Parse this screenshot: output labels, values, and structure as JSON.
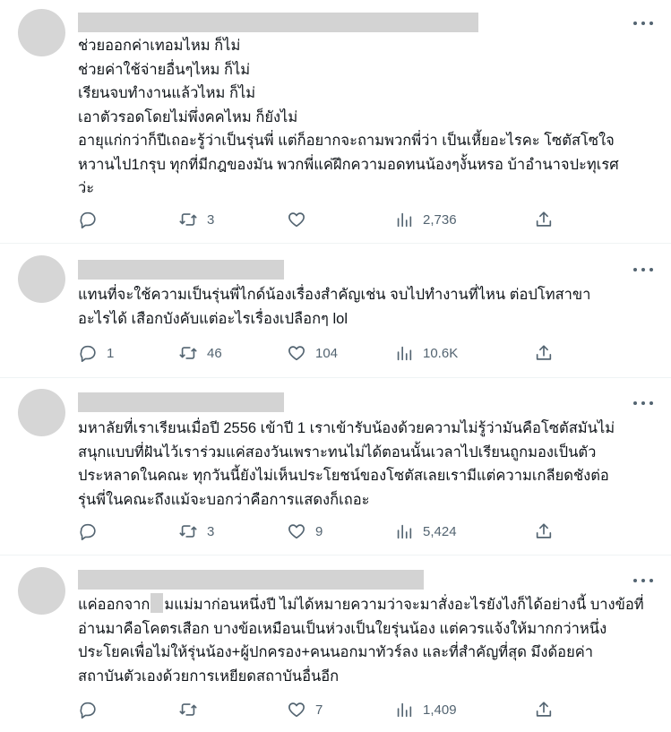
{
  "tweets": [
    {
      "lines": [
        "ช่วยออกค่าเทอมไหม ก็ไม่",
        "ช่วยค่าใช้จ่ายอื่นๆไหม ก็ไม่",
        "เรียนจบทำงานแล้วไหม ก็ไม่",
        "เอาตัวรอดโดยไม่พึ่งคคไหม ก็ยังไม่",
        "อายุแก่กว่าก็ปีเถอะรู้ว่าเป็นรุ่นพี่ แต่ก็อยากจะถามพวกพี่ว่า เป็นเหี้ยอะไรคะ โซตัสโซใจ",
        "หวานไป1กรุบ ทุกที่มีกฎของมัน พวกพี่แค่ฝึกความอดทนน้องๆงั้นหรอ บ้าอำนาจปะทุเรศ",
        "ว่ะ"
      ],
      "reply_count": "",
      "retweet_count": "3",
      "like_count": "",
      "view_count": "2,736"
    },
    {
      "lines": [
        "แทนที่จะใช้ความเป็นรุ่นพี่ไกด์น้องเรื่องสำคัญเช่น จบไปทำงานที่ไหน ต่อปโทสาขา",
        "อะไรได้ เสือกบังคับแต่อะไรเรื่องเปลือกๆ lol"
      ],
      "reply_count": "1",
      "retweet_count": "46",
      "like_count": "104",
      "view_count": "10.6K"
    },
    {
      "lines": [
        "มหาลัยที่เราเรียนเมื่อปี 2556 เข้าปี 1 เราเข้ารับน้องด้วยความไม่รู้ว่ามันคือโซตัสมันไม่",
        "สนุกแบบที่ฝันไว้เราร่วมแค่สองวันเพราะทนไม่ได้ตอนนั้นเวลาไปเรียนถูกมองเป็นตัว",
        "ประหลาดในคณะ ทุกวันนี้ยังไม่เห็นประโยชน์ของโซตัสเลยเรามีแต่ความเกลียดชังต่อ",
        "รุ่นพี่ในคณะถึงแม้จะบอกว่าคือการแสดงก็เถอะ"
      ],
      "reply_count": "",
      "retweet_count": "3",
      "like_count": "9",
      "view_count": "5,424"
    },
    {
      "line1_before": "แค่ออกจาก",
      "line1_after": "มแม่มาก่อนหนึ่งปี ไม่ได้หมายความว่าจะมาสั่งอะไรยังไงก็ได้อย่างนี้ บางข้อที่",
      "lines_rest": [
        "อ่านมาคือโคตรเสือก บางข้อเหมือนเป็นห่วงเป็นใยรุ่นน้อง แต่ควรแจ้งให้มากกว่าหนึ่ง",
        "ประโยคเพื่อไม่ให้รุ่นน้อง+ผู้ปกครอง+คนนอกมาทัวร์ลง และที่สำคัญที่สุด มึงด้อยค่า",
        "สถาบันตัวเองด้วยการเหยียดสถาบันอื่นอีก"
      ],
      "reply_count": "",
      "retweet_count": "",
      "like_count": "7",
      "view_count": "1,409"
    }
  ],
  "icons": {
    "reply": "reply-icon",
    "retweet": "retweet-icon",
    "like": "like-icon",
    "views": "views-icon",
    "share": "share-icon",
    "more": "more-icon"
  },
  "colors": {
    "text": "#0f1419",
    "muted": "#536471",
    "placeholder": "#d3d3d3",
    "divider": "#eff3f4"
  }
}
